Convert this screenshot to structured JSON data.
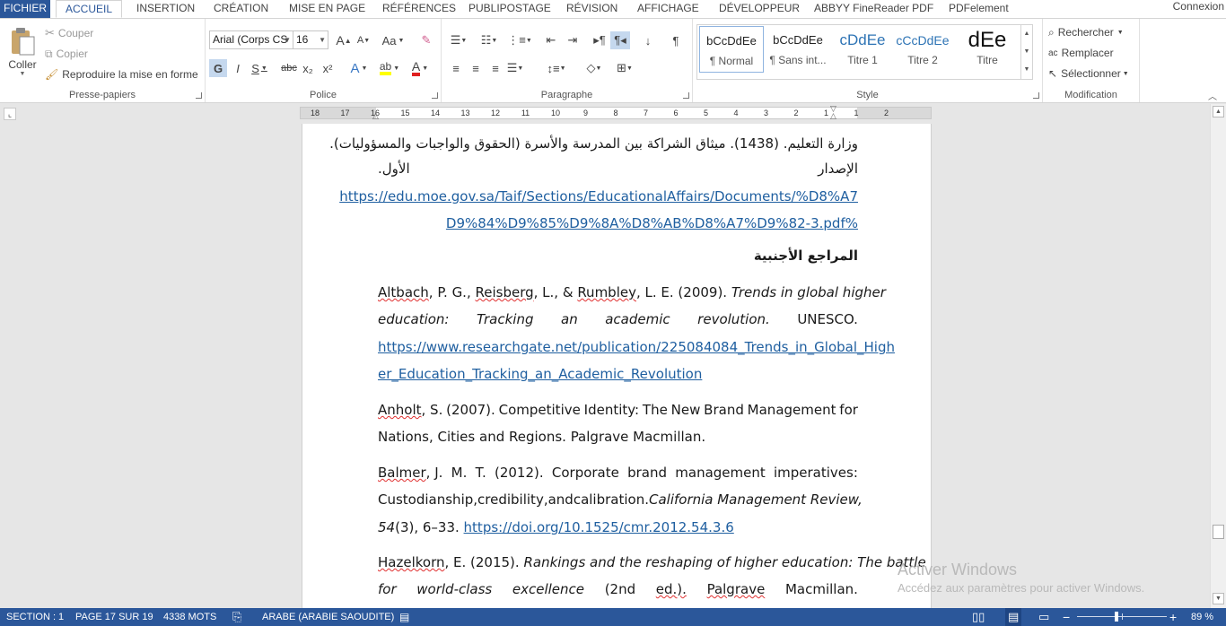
{
  "tabs": {
    "file": "FICHIER",
    "home": "ACCUEIL",
    "insert": "INSERTION",
    "design": "CRÉATION",
    "layout": "MISE EN PAGE",
    "references": "RÉFÉRENCES",
    "mailings": "PUBLIPOSTAGE",
    "review": "RÉVISION",
    "view": "AFFICHAGE",
    "developer": "DÉVELOPPEUR",
    "abbyy": "ABBYY FineReader PDF",
    "pdfelement": "PDFelement",
    "signin": "Connexion"
  },
  "clipboard": {
    "paste": "Coller",
    "cut": "Couper",
    "copy": "Copier",
    "format_painter": "Reproduire la mise en forme",
    "label": "Presse-papiers"
  },
  "font": {
    "name": "Arial (Corps CS",
    "size": "16",
    "label": "Police",
    "bold": "G",
    "italic": "I",
    "underline": "S",
    "strike": "abc",
    "sub": "x₂",
    "sup": "x²",
    "grow": "A",
    "shrink": "A",
    "case": "Aa",
    "effects": "A",
    "color_a": "A"
  },
  "paragraph": {
    "label": "Paragraphe",
    "pilcrow": "¶"
  },
  "styles": {
    "label": "Style",
    "items": [
      {
        "sample": "bCcDdEe",
        "name": "¶ Normal"
      },
      {
        "sample": "bCcDdEe",
        "name": "¶ Sans int..."
      },
      {
        "sample": "cDdEe",
        "name": "Titre 1"
      },
      {
        "sample": "cCcDdEe",
        "name": "Titre 2"
      },
      {
        "sample": "dEe",
        "name": "Titre"
      }
    ]
  },
  "editing": {
    "find": "Rechercher",
    "replace": "Remplacer",
    "select": "Sélectionner",
    "label": "Modification"
  },
  "ruler": {
    "numbers": [
      "18",
      "17",
      "16",
      "15",
      "14",
      "13",
      "12",
      "11",
      "10",
      "9",
      "8",
      "7",
      "6",
      "5",
      "4",
      "3",
      "2",
      "1",
      "1",
      "2"
    ]
  },
  "document": {
    "ar_line1": "وزارة التعليم. (1438). ميثاق الشراكة بين المدرسة والأسرة (الحقوق والواجبات والمسؤوليات).",
    "ar_line2a": "الإصدار",
    "ar_line2b": "الأول.",
    "url1a": "https://edu.moe.gov.sa/Taif/Sections/EducationalAffairs/Documents/%D8%A7",
    "url1b": "%D9%84%D9%85%D9%8A%D8%AB%D8%A7%D9%82-3.pdf",
    "heading": "المراجع الأجنبية",
    "ref1": {
      "a1": "Altbach",
      "a2": ", P. G., ",
      "a3": "Reisberg",
      "a4": ", L., & ",
      "a5": "Rumbley",
      "a6": ", L. E. (2009). ",
      "t1": "Trends in global higher",
      "w1": "education:",
      "w2": "Tracking",
      "w3": "an",
      "w4": "academic",
      "w5": "revolution.",
      "w6": "UNESCO.",
      "url_a": "https://www.researchgate.net/publication/225084084_Trends_in_Global_High",
      "url_b": "er_Education_Tracking_an_Academic_Revolution"
    },
    "ref2": {
      "a1": "Anholt",
      "w1": ", S.",
      "w2": "(2007).",
      "w3": "Competitive",
      "w4": "Identity:",
      "w5": "The",
      "w6": "New",
      "w7": "Brand",
      "w8": "Management",
      "w9": "for",
      "line2": "Nations, Cities and Regions. Palgrave Macmillan."
    },
    "ref3": {
      "a1": "Balmer",
      "w1": ", J.",
      "w2": "M.",
      "w3": "T.",
      "w4": "(2012).",
      "w5": "Corporate",
      "w6": "brand",
      "w7": "management",
      "w8": "imperatives:",
      "l2w1": "Custodianship,",
      "l2w2": "credibility,",
      "l2w3": "and",
      "l2w4": "calibration.",
      "l2w5": "California Management Review,",
      "l3a": "54",
      "l3b": "(3), 6–33. ",
      "l3url": "https://doi.org/10.1525/cmr.2012.54.3.6"
    },
    "ref4": {
      "a1": "Hazelkorn",
      "a2": ", E. (2015). ",
      "t1": "Rankings and the reshaping of higher education: The battle",
      "w1": "for",
      "w2": "world-class",
      "w3": "excellence",
      "w4": "(2nd",
      "w5": "ed.).",
      "w6": "Palgrave",
      "w7": "Macmillan."
    }
  },
  "watermark": {
    "title": "Activer Windows",
    "subtitle": "Accédez aux paramètres pour activer Windows."
  },
  "status": {
    "section": "SECTION : 1",
    "page": "PAGE 17 SUR 19",
    "words": "4338 MOTS",
    "language": "ARABE (ARABIE SAOUDITE)",
    "zoom": "89 %"
  },
  "colors": {
    "accent": "#2b579a",
    "link": "#1f5fa0"
  }
}
